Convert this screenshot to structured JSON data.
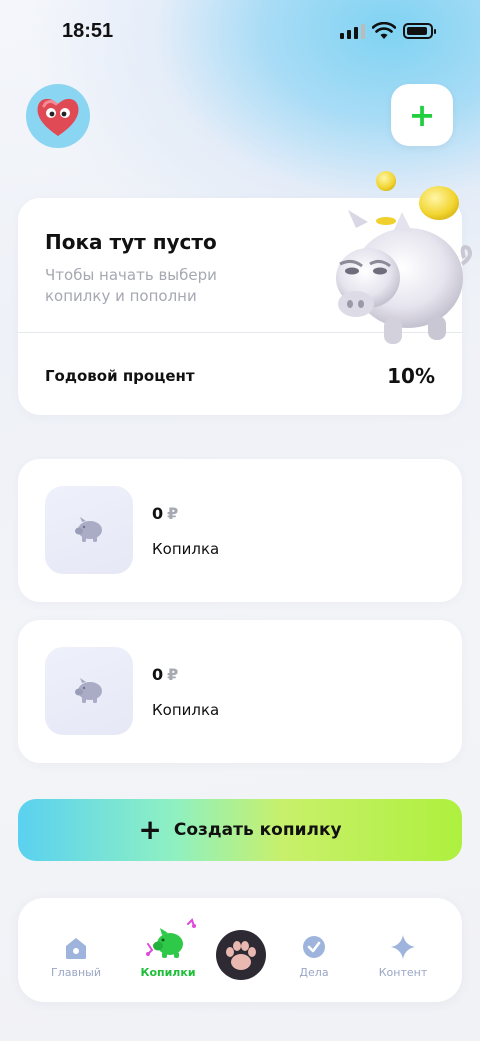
{
  "status_bar": {
    "time": "18:51"
  },
  "hero": {
    "title": "Пока тут пусто",
    "subtitle": "Чтобы начать выбери копилку и пополни",
    "rate_label": "Годовой процент",
    "rate_value": "10%"
  },
  "piggy_banks": [
    {
      "amount": "0",
      "currency": "₽",
      "name": "Копилка"
    },
    {
      "amount": "0",
      "currency": "₽",
      "name": "Копилка"
    }
  ],
  "create_button": {
    "icon": "plus-icon",
    "label": "Создать копилку"
  },
  "tabs": [
    {
      "label": "Главный",
      "icon": "home-icon",
      "active": false
    },
    {
      "label": "Копилки",
      "icon": "piggy-bank-icon",
      "active": true
    },
    {
      "label": "",
      "icon": "paw-icon",
      "active": false
    },
    {
      "label": "Дела",
      "icon": "check-circle-icon",
      "active": false
    },
    {
      "label": "Контент",
      "icon": "sparkle-icon",
      "active": false
    }
  ],
  "colors": {
    "accent_green": "#1fcf3d",
    "tab_inactive": "#9aa6c4",
    "muted_text": "#a6a8b2",
    "create_gradient": [
      "#5ad1f0",
      "#aef03e"
    ]
  }
}
